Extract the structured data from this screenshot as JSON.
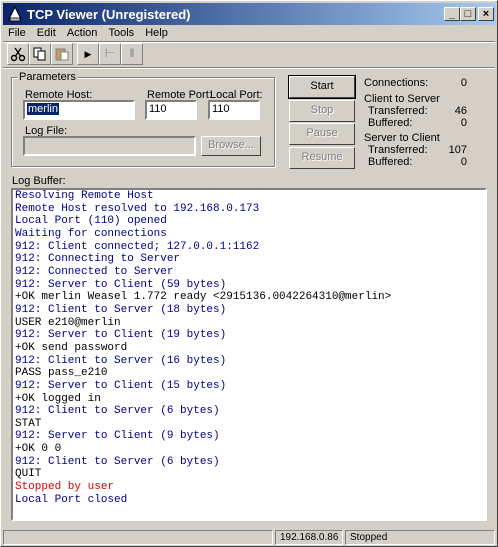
{
  "window": {
    "title": "TCP Viewer (Unregistered)"
  },
  "titlebar_buttons": {
    "minimize": "_",
    "maximize": "□",
    "close": "×"
  },
  "menu": [
    {
      "label": "File"
    },
    {
      "label": "Edit"
    },
    {
      "label": "Action"
    },
    {
      "label": "Tools"
    },
    {
      "label": "Help"
    }
  ],
  "toolbar": {
    "icons": [
      "scissors-icon",
      "copy-icon",
      "paste-icon",
      "play-icon",
      "step-icon",
      "pause-icon"
    ],
    "play_glyph": "▶",
    "step_glyph": "⊢",
    "pause_glyph": "‖"
  },
  "parameters": {
    "group_label": "Parameters",
    "remote_host_label": "Remote Host:",
    "remote_host_value": "merlin",
    "remote_port_label": "Remote Port:",
    "remote_port_value": "110",
    "local_port_label": "Local Port:",
    "local_port_value": "110",
    "log_file_label": "Log File:",
    "log_file_value": "",
    "browse_label": "Browse..."
  },
  "actions": {
    "start": "Start",
    "stop": "Stop",
    "pause": "Pause",
    "resume": "Resume"
  },
  "stats": {
    "connections_label": "Connections:",
    "connections_value": "0",
    "c2s_label": "Client to Server",
    "c2s_transferred_label": "Transferred:",
    "c2s_transferred_value": "46",
    "c2s_buffered_label": "Buffered:",
    "c2s_buffered_value": "0",
    "s2c_label": "Server to Client",
    "s2c_transferred_label": "Transferred:",
    "s2c_transferred_value": "107",
    "s2c_buffered_label": "Buffered:",
    "s2c_buffered_value": "0"
  },
  "log": {
    "label": "Log Buffer:",
    "colors": {
      "info": "#00008b",
      "data": "#000000",
      "error": "#e00000"
    },
    "lines": [
      {
        "text": "Resolving Remote Host",
        "kind": "info"
      },
      {
        "text": "Remote Host resolved to 192.168.0.173",
        "kind": "info"
      },
      {
        "text": "Local Port (110) opened",
        "kind": "info"
      },
      {
        "text": "Waiting for connections",
        "kind": "info"
      },
      {
        "text": "912: Client connected; 127.0.0.1:1162",
        "kind": "info"
      },
      {
        "text": "912: Connecting to Server",
        "kind": "info"
      },
      {
        "text": "912: Connected to Server",
        "kind": "info"
      },
      {
        "text": "912: Server to Client (59 bytes)",
        "kind": "info"
      },
      {
        "text": "+OK merlin Weasel 1.772 ready <2915136.0042264310@merlin>",
        "kind": "data"
      },
      {
        "text": "912: Client to Server (18 bytes)",
        "kind": "info"
      },
      {
        "text": "USER e210@merlin",
        "kind": "data"
      },
      {
        "text": "912: Server to Client (19 bytes)",
        "kind": "info"
      },
      {
        "text": "+OK send password",
        "kind": "data"
      },
      {
        "text": "912: Client to Server (16 bytes)",
        "kind": "info"
      },
      {
        "text": "PASS pass_e210",
        "kind": "data"
      },
      {
        "text": "912: Server to Client (15 bytes)",
        "kind": "info"
      },
      {
        "text": "+OK logged in",
        "kind": "data"
      },
      {
        "text": "912: Client to Server (6 bytes)",
        "kind": "info"
      },
      {
        "text": "STAT",
        "kind": "data"
      },
      {
        "text": "912: Server to Client (9 bytes)",
        "kind": "info"
      },
      {
        "text": "+OK 0 0",
        "kind": "data"
      },
      {
        "text": "912: Client to Server (6 bytes)",
        "kind": "info"
      },
      {
        "text": "QUIT",
        "kind": "data"
      },
      {
        "text": "Stopped by user",
        "kind": "error"
      },
      {
        "text": "Local Port closed",
        "kind": "info"
      }
    ]
  },
  "status": {
    "ip": "192.168.0.86",
    "state": "Stopped"
  }
}
